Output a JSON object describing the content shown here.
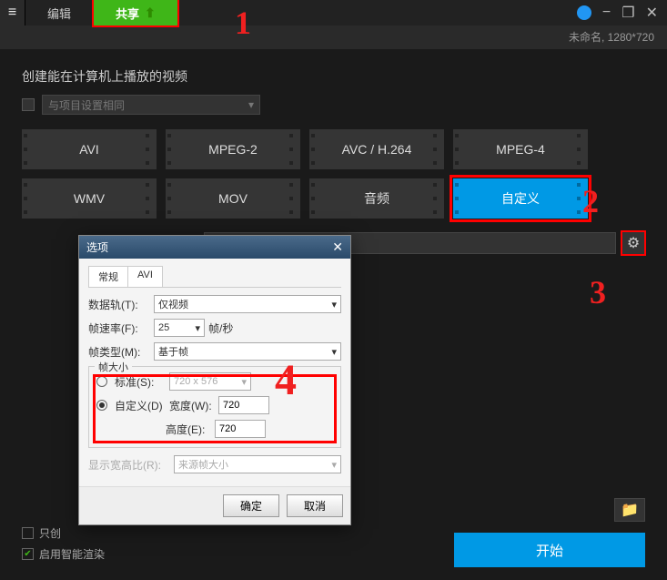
{
  "titlebar": {
    "tabs": {
      "edit": "编辑",
      "share": "共享"
    },
    "win": {
      "min": "−",
      "max": "❐",
      "close": "✕"
    }
  },
  "subbar": {
    "project_info": "未命名, 1280*720"
  },
  "main": {
    "heading": "创建能在计算机上播放的视频",
    "same_as_project": "与项目设置相同",
    "formats": [
      "AVI",
      "MPEG-2",
      "AVC / H.264",
      "MPEG-4",
      "WMV",
      "MOV",
      "音频",
      "自定义"
    ],
    "only_create": "只创",
    "smart_render": "启用智能渲染",
    "start": "开始"
  },
  "dialog": {
    "title": "选项",
    "tabs": {
      "general": "常规",
      "avi": "AVI"
    },
    "rows": {
      "track_label": "数据轨(T):",
      "track_value": "仅视频",
      "fps_label": "帧速率(F):",
      "fps_value": "25",
      "fps_unit": "帧/秒",
      "frametype_label": "帧类型(M):",
      "frametype_value": "基于帧"
    },
    "framesize": {
      "legend": "帧大小",
      "standard_label": "标准(S):",
      "standard_value": "720 x 576",
      "custom_label": "自定义(D)",
      "width_label": "宽度(W):",
      "width_value": "720",
      "height_label": "高度(E):",
      "height_value": "720"
    },
    "aspect": {
      "label": "显示宽高比(R):",
      "value": "来源帧大小"
    },
    "buttons": {
      "ok": "确定",
      "cancel": "取消"
    }
  },
  "anno": {
    "n1": "1",
    "n2": "2",
    "n3": "3",
    "n4": "4"
  }
}
